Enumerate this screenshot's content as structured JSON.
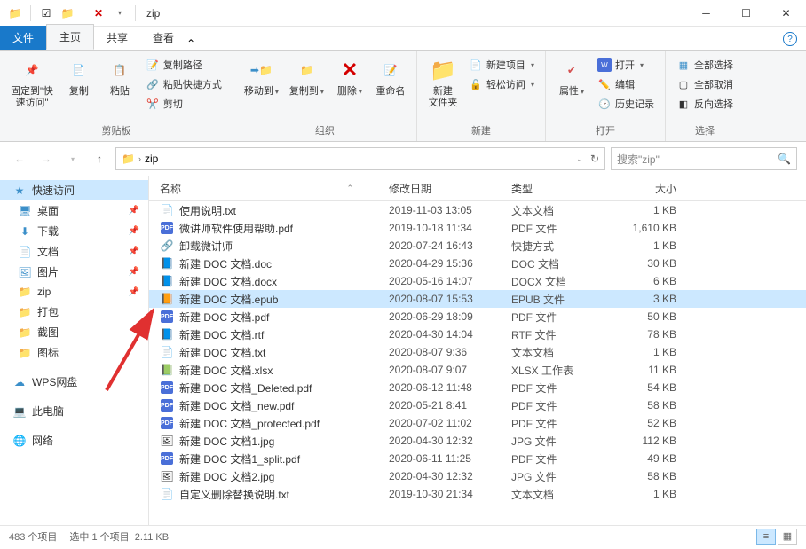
{
  "window": {
    "title": "zip"
  },
  "tabs": {
    "file": "文件",
    "home": "主页",
    "share": "共享",
    "view": "查看"
  },
  "ribbon": {
    "pin_label": "固定到\"快\n速访问\"",
    "copy": "复制",
    "paste": "粘贴",
    "copy_path": "复制路径",
    "paste_shortcut": "粘贴快捷方式",
    "cut": "剪切",
    "group_clipboard": "剪贴板",
    "move_to": "移动到",
    "copy_to": "复制到",
    "delete": "删除",
    "rename": "重命名",
    "group_organize": "组织",
    "new_folder": "新建\n文件夹",
    "new_item": "新建项目",
    "easy_access": "轻松访问",
    "group_new": "新建",
    "properties": "属性",
    "open": "打开",
    "edit": "编辑",
    "history": "历史记录",
    "group_open": "打开",
    "select_all": "全部选择",
    "select_none": "全部取消",
    "invert_sel": "反向选择",
    "group_select": "选择"
  },
  "address": {
    "folder": "zip"
  },
  "search": {
    "placeholder": "搜索\"zip\""
  },
  "columns": {
    "name": "名称",
    "date": "修改日期",
    "type": "类型",
    "size": "大小"
  },
  "sidebar": {
    "quick": "快速访问",
    "desktop": "桌面",
    "downloads": "下载",
    "documents": "文档",
    "pictures": "图片",
    "zip": "zip",
    "pack": "打包",
    "screenshot": "截图",
    "icons": "图标",
    "wps": "WPS网盘",
    "thispc": "此电脑",
    "network": "网络"
  },
  "files": [
    {
      "name": "使用说明.txt",
      "date": "2019-11-03 13:05",
      "type": "文本文档",
      "size": "1 KB",
      "icon": "txt"
    },
    {
      "name": "微讲师软件使用帮助.pdf",
      "date": "2019-10-18 11:34",
      "type": "PDF 文件",
      "size": "1,610 KB",
      "icon": "pdf"
    },
    {
      "name": "卸载微讲师",
      "date": "2020-07-24 16:43",
      "type": "快捷方式",
      "size": "1 KB",
      "icon": "link"
    },
    {
      "name": "新建 DOC 文档.doc",
      "date": "2020-04-29 15:36",
      "type": "DOC 文档",
      "size": "30 KB",
      "icon": "doc"
    },
    {
      "name": "新建 DOC 文档.docx",
      "date": "2020-05-16 14:07",
      "type": "DOCX 文档",
      "size": "6 KB",
      "icon": "doc"
    },
    {
      "name": "新建 DOC 文档.epub",
      "date": "2020-08-07 15:53",
      "type": "EPUB 文件",
      "size": "3 KB",
      "icon": "epub",
      "selected": true
    },
    {
      "name": "新建 DOC 文档.pdf",
      "date": "2020-06-29 18:09",
      "type": "PDF 文件",
      "size": "50 KB",
      "icon": "pdf"
    },
    {
      "name": "新建 DOC 文档.rtf",
      "date": "2020-04-30 14:04",
      "type": "RTF 文件",
      "size": "78 KB",
      "icon": "doc"
    },
    {
      "name": "新建 DOC 文档.txt",
      "date": "2020-08-07 9:36",
      "type": "文本文档",
      "size": "1 KB",
      "icon": "txt"
    },
    {
      "name": "新建 DOC 文档.xlsx",
      "date": "2020-08-07 9:07",
      "type": "XLSX 工作表",
      "size": "11 KB",
      "icon": "xls"
    },
    {
      "name": "新建 DOC 文档_Deleted.pdf",
      "date": "2020-06-12 11:48",
      "type": "PDF 文件",
      "size": "54 KB",
      "icon": "pdf"
    },
    {
      "name": "新建 DOC 文档_new.pdf",
      "date": "2020-05-21 8:41",
      "type": "PDF 文件",
      "size": "58 KB",
      "icon": "pdf"
    },
    {
      "name": "新建 DOC 文档_protected.pdf",
      "date": "2020-07-02 11:02",
      "type": "PDF 文件",
      "size": "52 KB",
      "icon": "pdf"
    },
    {
      "name": "新建 DOC 文档1.jpg",
      "date": "2020-04-30 12:32",
      "type": "JPG 文件",
      "size": "112 KB",
      "icon": "jpg"
    },
    {
      "name": "新建 DOC 文档1_split.pdf",
      "date": "2020-06-11 11:25",
      "type": "PDF 文件",
      "size": "49 KB",
      "icon": "pdf"
    },
    {
      "name": "新建 DOC 文档2.jpg",
      "date": "2020-04-30 12:32",
      "type": "JPG 文件",
      "size": "58 KB",
      "icon": "jpg"
    },
    {
      "name": "自定义删除替换说明.txt",
      "date": "2019-10-30 21:34",
      "type": "文本文档",
      "size": "1 KB",
      "icon": "txt"
    }
  ],
  "status": {
    "items": "483 个项目",
    "selected": "选中 1 个项目",
    "size": "2.11 KB"
  },
  "top_row_partial": {
    "date_prefix": "2020",
    "size_suffix": "KB"
  }
}
